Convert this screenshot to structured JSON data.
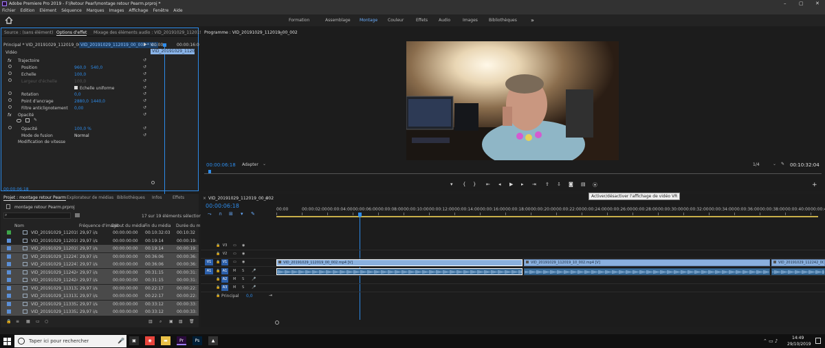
{
  "window": {
    "title": "Adobe Premiere Pro 2019 - F:\\Retour Pearl\\montage retour Pearm.prproj *",
    "minimize": "–",
    "maximize": "▢",
    "close": "✕"
  },
  "menubar": [
    "Fichier",
    "Edition",
    "Elément",
    "Séquence",
    "Marques",
    "Images",
    "Affichage",
    "Fenêtre",
    "Aide"
  ],
  "workspaces": [
    "Formation",
    "Assemblage",
    "Montage",
    "Couleur",
    "Effets",
    "Audio",
    "Images",
    "Bibliothèques"
  ],
  "workspace_overflow": "»",
  "source_panel": {
    "tabs": [
      "Source : (sans élément)",
      "Options d'effet",
      "Mixage des éléments audio : VID_20191029_112019_00_0"
    ],
    "clip_selector": "Principal * VID_20191029_112019_00_...",
    "clip_target": "VID_20191029_112019_00_002 * V...",
    "time_start": ":00:00",
    "time_end": "00:00:16:0",
    "mini_clip": "VID_20191029_112019_0",
    "section_video": "Vidéo",
    "rows": [
      {
        "label": "Trajectoire",
        "fx": "fx",
        "v1": "",
        "v2": ""
      },
      {
        "label": "Position",
        "v1": "960,0",
        "v2": "540,0"
      },
      {
        "label": "Echelle",
        "v1": "100,0",
        "v2": ""
      },
      {
        "label": "Largeur d'échelle",
        "v1": "100,0",
        "v2": ""
      },
      {
        "label": "Echelle uniforme",
        "v1": "",
        "v2": ""
      },
      {
        "label": "Rotation",
        "v1": "0,0",
        "v2": ""
      },
      {
        "label": "Point d'ancrage",
        "v1": "2880,0",
        "v2": "1440,0"
      },
      {
        "label": "Filtre anticlignotement",
        "v1": "0,00",
        "v2": ""
      },
      {
        "label": "Opacité",
        "fx": "fx",
        "v1": "",
        "v2": ""
      },
      {
        "label": "Opacité",
        "v1": "100,0 %",
        "v2": ""
      },
      {
        "label": "Mode de fusion",
        "v1": "Normal",
        "v2": ""
      },
      {
        "label": "Modification de vitesse",
        "v1": "",
        "v2": ""
      }
    ],
    "timecode": "00:00:06:18"
  },
  "program": {
    "tab": "Programme : VID_20191029_112019_00_002",
    "timecode": "00:00:06:18",
    "fit": "Adapter",
    "quality": "1/4",
    "duration": "00:10:32:04",
    "tooltip": "Activer/désactiver l'affichage de vidéo VR"
  },
  "project": {
    "tabs": [
      "Projet : montage retour Pearm",
      "Explorateur de médias",
      "Bibliothèques",
      "Infos",
      "Effets"
    ],
    "file": "montage retour Pearm.prproj",
    "selection_info": "17 sur 19 éléments sélectionné(s)",
    "columns": [
      "Nom",
      "Fréquence d'image",
      "Début du média",
      "Fin du média",
      "Durée du m"
    ],
    "items": [
      {
        "name": "VID_20191029_112019_00_",
        "fps": "29,97 i/s",
        "start": "00:00:00:00",
        "end": "00:10:32:03",
        "dur": "00:10:32",
        "color": "#3ea54a",
        "sel": false
      },
      {
        "name": "VID_20191029_112019_00_",
        "fps": "29,97 i/s",
        "start": "00:00:00:00",
        "end": "00:19:14",
        "dur": "00:00:19:",
        "color": "#5b8fd6",
        "sel": false
      },
      {
        "name": "VID_20191029_112019_00_",
        "fps": "29,97 i/s",
        "start": "00:00:00:00",
        "end": "00:19:14",
        "dur": "00:00:19:",
        "color": "#5b8fd6",
        "sel": true
      },
      {
        "name": "VID_20191029_112241_00_",
        "fps": "29,97 i/s",
        "start": "00:00:00:00",
        "end": "00:36:06",
        "dur": "00:00:36:",
        "color": "#5b8fd6",
        "sel": true
      },
      {
        "name": "VID_20191029_112241_00_",
        "fps": "29,97 i/s",
        "start": "00:00:00:00",
        "end": "00:36:06",
        "dur": "00:00:36:",
        "color": "#5b8fd6",
        "sel": true
      },
      {
        "name": "VID_20191029_112424_00_",
        "fps": "29,97 i/s",
        "start": "00:00:00:00",
        "end": "00:31:15",
        "dur": "00:00:31:",
        "color": "#5b8fd6",
        "sel": true
      },
      {
        "name": "VID_20191029_112424_00_",
        "fps": "29,97 i/s",
        "start": "00:00:00:00",
        "end": "00:31:15",
        "dur": "00:00:31:",
        "color": "#5b8fd6",
        "sel": true
      },
      {
        "name": "VID_20191029_113132_00_",
        "fps": "29,97 i/s",
        "start": "00:00:00:00",
        "end": "00:22:17",
        "dur": "00:00:22:",
        "color": "#5b8fd6",
        "sel": true
      },
      {
        "name": "VID_20191029_113132_00_",
        "fps": "29,97 i/s",
        "start": "00:00:00:00",
        "end": "00:22:17",
        "dur": "00:00:22:",
        "color": "#5b8fd6",
        "sel": true
      },
      {
        "name": "VID_20191029_113352_00_",
        "fps": "29,97 i/s",
        "start": "00:00:00:00",
        "end": "00:33:12",
        "dur": "00:00:33:",
        "color": "#5b8fd6",
        "sel": true
      },
      {
        "name": "VID_20191029_113352_00_",
        "fps": "29,97 i/s",
        "start": "00:00:00:00",
        "end": "00:33:12",
        "dur": "00:00:33:",
        "color": "#5b8fd6",
        "sel": true
      }
    ]
  },
  "timeline": {
    "tab": "VID_20191029_112019_00_002",
    "timecode": "00:00:06:18",
    "ruler": [
      "00:00",
      "00:00:02:00",
      "00:00:04:00",
      "00:00:06:00",
      "00:00:08:00",
      "00:00:10:00",
      "00:00:12:00",
      "00:00:14:00",
      "00:00:16:00",
      "00:00:18:00",
      "00:00:20:00",
      "00:00:22:00",
      "00:00:24:00",
      "00:00:26:00",
      "00:00:28:00",
      "00:00:30:00",
      "00:00:32:00",
      "00:00:34:00",
      "00:00:36:00",
      "00:00:38:00",
      "00:00:40:00",
      "00:00:42:0"
    ],
    "video_tracks": [
      "V3",
      "V2",
      "V1"
    ],
    "audio_tracks": [
      "A1",
      "A2",
      "A3"
    ],
    "src_v": "V1",
    "src_a": "A1",
    "master_label": "Principal",
    "master_value": "0,0",
    "clips": [
      "VID_20191029_112019_00_002.mp4 [V]",
      "VID_20191029_112019_10_002.mp4 [V]",
      "VID_20191029_112242_00"
    ]
  },
  "taskbar": {
    "search": "Taper ici pour rechercher",
    "time": "14:49",
    "date": "29/10/2019"
  }
}
